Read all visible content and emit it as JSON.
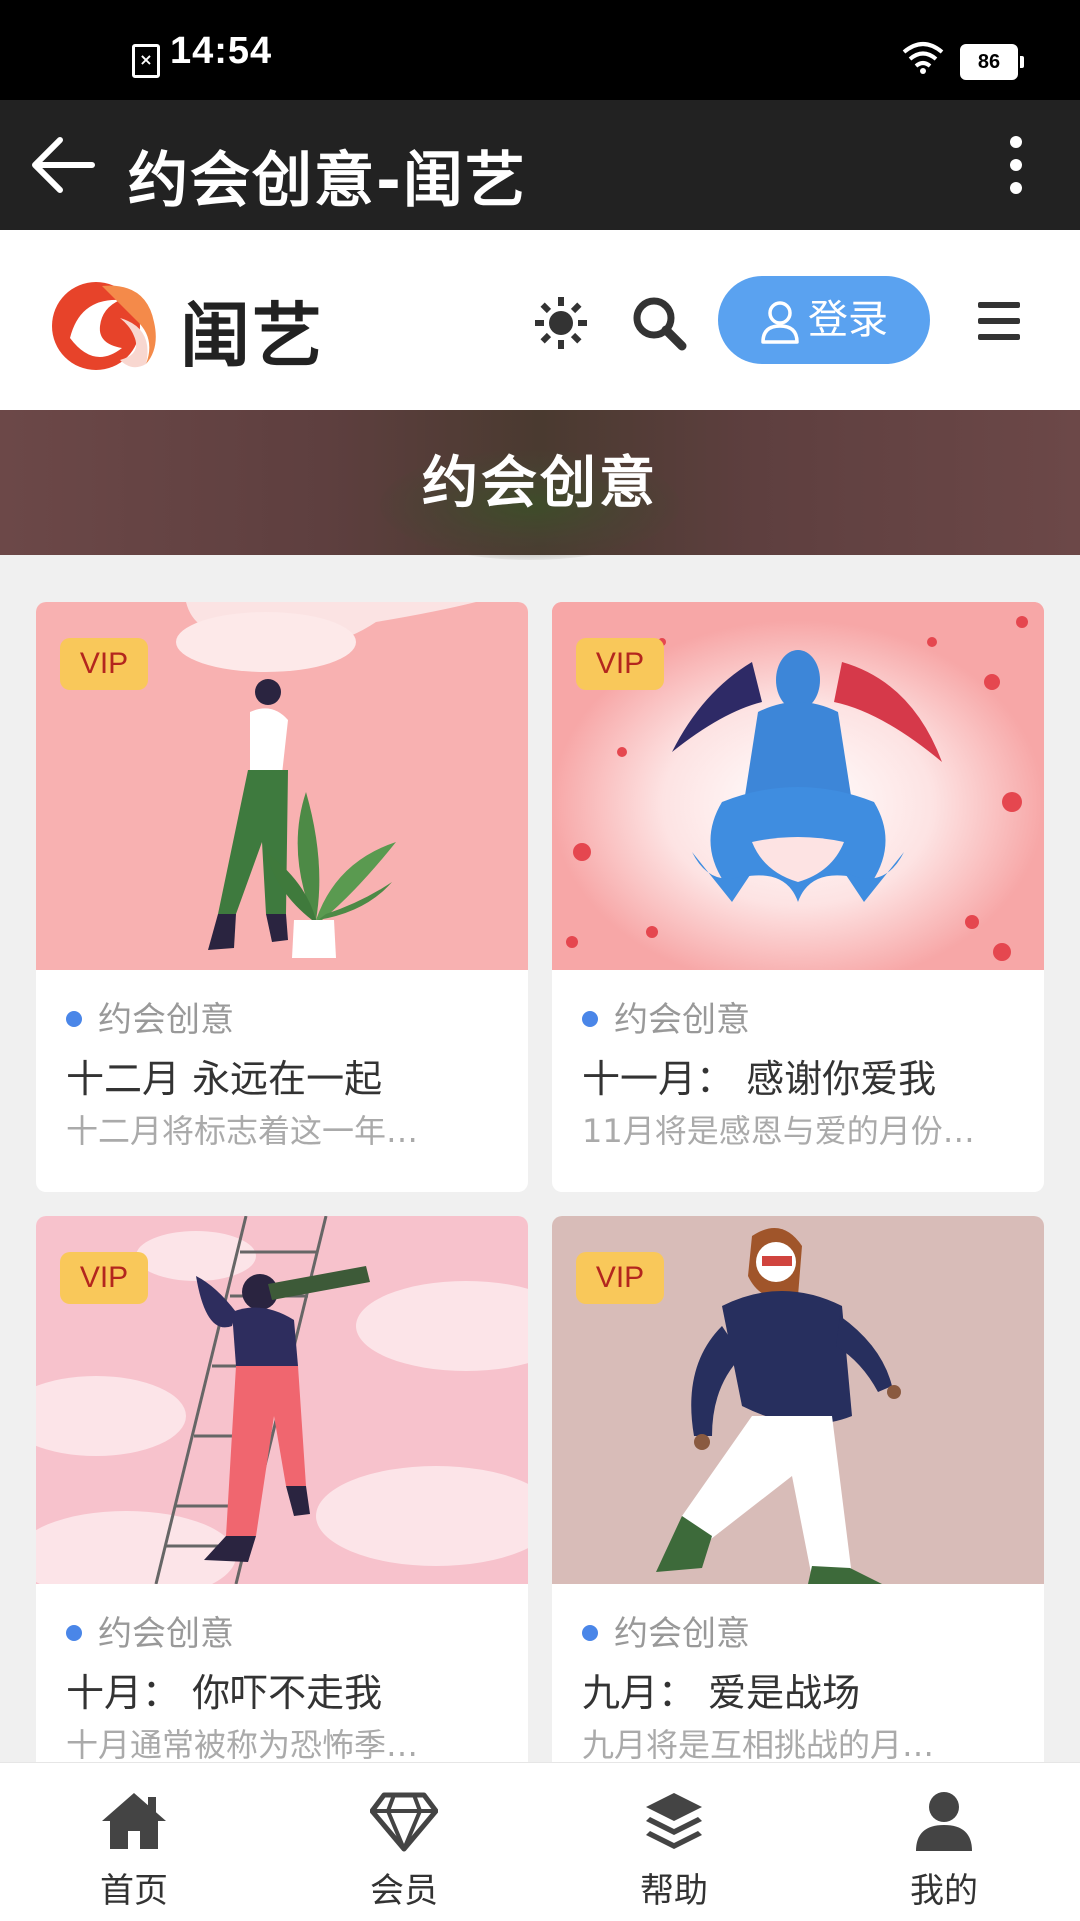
{
  "status": {
    "time": "14:54",
    "battery": "86",
    "sim_icon": "sim-card-x-icon"
  },
  "appbar": {
    "title": "约会创意-闺艺",
    "back_icon": "arrow-left-icon",
    "more_icon": "more-vertical-icon"
  },
  "header": {
    "brand": "闺艺",
    "login_label": "登录",
    "icons": [
      "theme-sun-icon",
      "search-icon",
      "user-icon",
      "menu-icon"
    ]
  },
  "banner": {
    "title": "约会创意"
  },
  "cards": [
    {
      "badge": "VIP",
      "category": "约会创意",
      "title": "十二月 永远在一起",
      "desc": "十二月将标志着这一年…"
    },
    {
      "badge": "VIP",
      "category": "约会创意",
      "title": "十一月： 感谢你爱我",
      "desc": "11月将是感恩与爱的月份…"
    },
    {
      "badge": "VIP",
      "category": "约会创意",
      "title": "十月： 你吓不走我",
      "desc": "十月通常被称为恐怖季…"
    },
    {
      "badge": "VIP",
      "category": "约会创意",
      "title": "九月： 爱是战场",
      "desc": "九月将是互相挑战的月…"
    }
  ],
  "bottom_nav": [
    {
      "label": "首页",
      "icon": "home-icon"
    },
    {
      "label": "会员",
      "icon": "diamond-icon"
    },
    {
      "label": "帮助",
      "icon": "layers-icon"
    },
    {
      "label": "我的",
      "icon": "user-icon"
    }
  ],
  "colors": {
    "accent": "#5aa2f0",
    "vip": "#f9c85a",
    "appbar": "#222222",
    "dot": "#4a86e8"
  }
}
